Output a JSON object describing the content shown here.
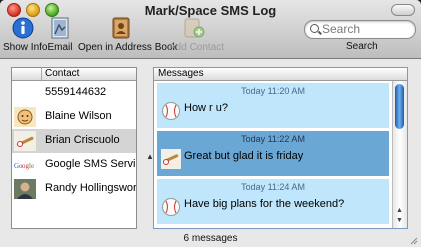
{
  "window": {
    "title": "Mark/Space SMS Log"
  },
  "toolbar": {
    "show_info": {
      "label": "Show Info",
      "icon": "info-icon"
    },
    "email": {
      "label": "Email",
      "icon": "mail-stamp-icon"
    },
    "address_book": {
      "label": "Open in Address Book",
      "icon": "address-book-icon"
    },
    "add_contact": {
      "label": "Add Contact",
      "icon": "add-contact-icon",
      "disabled": true
    }
  },
  "search": {
    "placeholder": "Search",
    "label": "Search"
  },
  "contacts": {
    "header": "Contact",
    "items": [
      {
        "name": "5559144632",
        "picture": "none"
      },
      {
        "name": "Blaine Wilson",
        "picture": "cartoon-avatar"
      },
      {
        "name": "Brian Criscuolo",
        "picture": "bat-icon",
        "selected": true
      },
      {
        "name": "Google SMS Service",
        "picture": "google-logo"
      },
      {
        "name": "Randy Hollingsworth",
        "picture": "person-photo"
      }
    ]
  },
  "messages": {
    "header": "Messages",
    "items": [
      {
        "time": "Today 11:20 AM",
        "text": "How r u?",
        "sender_icon": "baseball-icon"
      },
      {
        "time": "Today 11:22 AM",
        "text": "Great but glad it is friday",
        "sender_icon": "bat-icon",
        "selected": true
      },
      {
        "time": "Today 11:24 AM",
        "text": "Have big plans for the weekend?",
        "sender_icon": "baseball-icon"
      }
    ]
  },
  "status": {
    "text": "6 messages"
  },
  "colors": {
    "message_bg": "#bfe6fa",
    "message_selected": "#6aa7d4",
    "row_selected": "#d4d4d4"
  }
}
